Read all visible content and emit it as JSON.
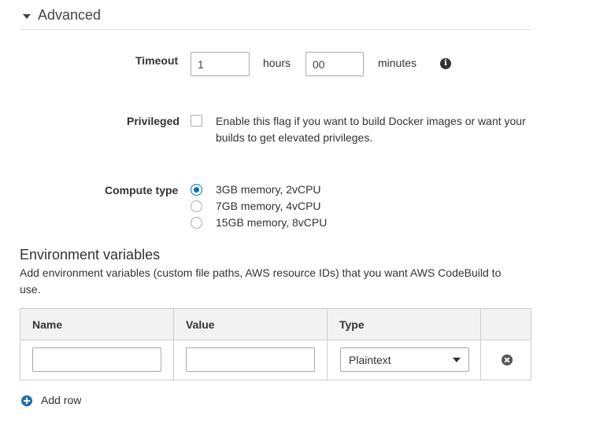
{
  "section": {
    "title": "Advanced"
  },
  "timeout": {
    "label": "Timeout",
    "hours_value": "1",
    "hours_unit": "hours",
    "minutes_value": "00",
    "minutes_unit": "minutes",
    "info_icon": "i"
  },
  "privileged": {
    "label": "Privileged",
    "checked": false,
    "description": "Enable this flag if you want to build Docker images or want your builds to get elevated privileges."
  },
  "compute": {
    "label": "Compute type",
    "options": [
      {
        "label": "3GB memory, 2vCPU",
        "selected": true
      },
      {
        "label": "7GB memory, 4vCPU",
        "selected": false
      },
      {
        "label": "15GB memory, 8vCPU",
        "selected": false
      }
    ]
  },
  "env": {
    "title": "Environment variables",
    "description": "Add environment variables (custom file paths, AWS resource IDs) that you want AWS CodeBuild to use.",
    "columns": [
      "Name",
      "Value",
      "Type"
    ],
    "row": {
      "name": "",
      "value": "",
      "type": "Plaintext"
    },
    "add_row_label": "Add row"
  },
  "colors": {
    "accent": "#0073bb",
    "add_icon": "#1f6fb5",
    "border": "#cccccc",
    "header_bg": "#f2f2f2"
  },
  "icons": {
    "collapse": "caret-down-icon",
    "info": "info-icon",
    "remove": "remove-circle-icon",
    "add": "plus-circle-icon",
    "select": "chevron-down-icon"
  }
}
